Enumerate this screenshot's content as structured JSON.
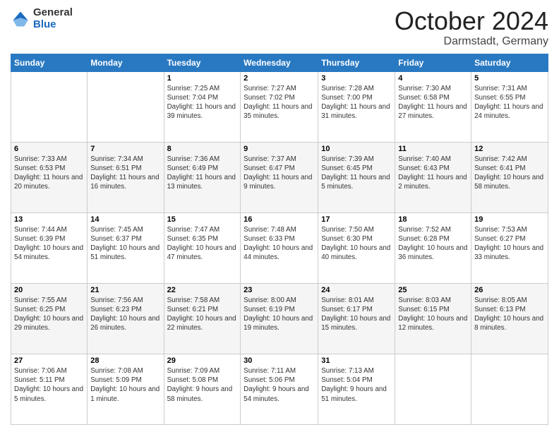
{
  "header": {
    "logo_general": "General",
    "logo_blue": "Blue",
    "title": "October 2024",
    "location": "Darmstadt, Germany"
  },
  "days_of_week": [
    "Sunday",
    "Monday",
    "Tuesday",
    "Wednesday",
    "Thursday",
    "Friday",
    "Saturday"
  ],
  "weeks": [
    [
      {
        "day": "",
        "info": ""
      },
      {
        "day": "",
        "info": ""
      },
      {
        "day": "1",
        "info": "Sunrise: 7:25 AM\nSunset: 7:04 PM\nDaylight: 11 hours and 39 minutes."
      },
      {
        "day": "2",
        "info": "Sunrise: 7:27 AM\nSunset: 7:02 PM\nDaylight: 11 hours and 35 minutes."
      },
      {
        "day": "3",
        "info": "Sunrise: 7:28 AM\nSunset: 7:00 PM\nDaylight: 11 hours and 31 minutes."
      },
      {
        "day": "4",
        "info": "Sunrise: 7:30 AM\nSunset: 6:58 PM\nDaylight: 11 hours and 27 minutes."
      },
      {
        "day": "5",
        "info": "Sunrise: 7:31 AM\nSunset: 6:55 PM\nDaylight: 11 hours and 24 minutes."
      }
    ],
    [
      {
        "day": "6",
        "info": "Sunrise: 7:33 AM\nSunset: 6:53 PM\nDaylight: 11 hours and 20 minutes."
      },
      {
        "day": "7",
        "info": "Sunrise: 7:34 AM\nSunset: 6:51 PM\nDaylight: 11 hours and 16 minutes."
      },
      {
        "day": "8",
        "info": "Sunrise: 7:36 AM\nSunset: 6:49 PM\nDaylight: 11 hours and 13 minutes."
      },
      {
        "day": "9",
        "info": "Sunrise: 7:37 AM\nSunset: 6:47 PM\nDaylight: 11 hours and 9 minutes."
      },
      {
        "day": "10",
        "info": "Sunrise: 7:39 AM\nSunset: 6:45 PM\nDaylight: 11 hours and 5 minutes."
      },
      {
        "day": "11",
        "info": "Sunrise: 7:40 AM\nSunset: 6:43 PM\nDaylight: 11 hours and 2 minutes."
      },
      {
        "day": "12",
        "info": "Sunrise: 7:42 AM\nSunset: 6:41 PM\nDaylight: 10 hours and 58 minutes."
      }
    ],
    [
      {
        "day": "13",
        "info": "Sunrise: 7:44 AM\nSunset: 6:39 PM\nDaylight: 10 hours and 54 minutes."
      },
      {
        "day": "14",
        "info": "Sunrise: 7:45 AM\nSunset: 6:37 PM\nDaylight: 10 hours and 51 minutes."
      },
      {
        "day": "15",
        "info": "Sunrise: 7:47 AM\nSunset: 6:35 PM\nDaylight: 10 hours and 47 minutes."
      },
      {
        "day": "16",
        "info": "Sunrise: 7:48 AM\nSunset: 6:33 PM\nDaylight: 10 hours and 44 minutes."
      },
      {
        "day": "17",
        "info": "Sunrise: 7:50 AM\nSunset: 6:30 PM\nDaylight: 10 hours and 40 minutes."
      },
      {
        "day": "18",
        "info": "Sunrise: 7:52 AM\nSunset: 6:28 PM\nDaylight: 10 hours and 36 minutes."
      },
      {
        "day": "19",
        "info": "Sunrise: 7:53 AM\nSunset: 6:27 PM\nDaylight: 10 hours and 33 minutes."
      }
    ],
    [
      {
        "day": "20",
        "info": "Sunrise: 7:55 AM\nSunset: 6:25 PM\nDaylight: 10 hours and 29 minutes."
      },
      {
        "day": "21",
        "info": "Sunrise: 7:56 AM\nSunset: 6:23 PM\nDaylight: 10 hours and 26 minutes."
      },
      {
        "day": "22",
        "info": "Sunrise: 7:58 AM\nSunset: 6:21 PM\nDaylight: 10 hours and 22 minutes."
      },
      {
        "day": "23",
        "info": "Sunrise: 8:00 AM\nSunset: 6:19 PM\nDaylight: 10 hours and 19 minutes."
      },
      {
        "day": "24",
        "info": "Sunrise: 8:01 AM\nSunset: 6:17 PM\nDaylight: 10 hours and 15 minutes."
      },
      {
        "day": "25",
        "info": "Sunrise: 8:03 AM\nSunset: 6:15 PM\nDaylight: 10 hours and 12 minutes."
      },
      {
        "day": "26",
        "info": "Sunrise: 8:05 AM\nSunset: 6:13 PM\nDaylight: 10 hours and 8 minutes."
      }
    ],
    [
      {
        "day": "27",
        "info": "Sunrise: 7:06 AM\nSunset: 5:11 PM\nDaylight: 10 hours and 5 minutes."
      },
      {
        "day": "28",
        "info": "Sunrise: 7:08 AM\nSunset: 5:09 PM\nDaylight: 10 hours and 1 minute."
      },
      {
        "day": "29",
        "info": "Sunrise: 7:09 AM\nSunset: 5:08 PM\nDaylight: 9 hours and 58 minutes."
      },
      {
        "day": "30",
        "info": "Sunrise: 7:11 AM\nSunset: 5:06 PM\nDaylight: 9 hours and 54 minutes."
      },
      {
        "day": "31",
        "info": "Sunrise: 7:13 AM\nSunset: 5:04 PM\nDaylight: 9 hours and 51 minutes."
      },
      {
        "day": "",
        "info": ""
      },
      {
        "day": "",
        "info": ""
      }
    ]
  ]
}
